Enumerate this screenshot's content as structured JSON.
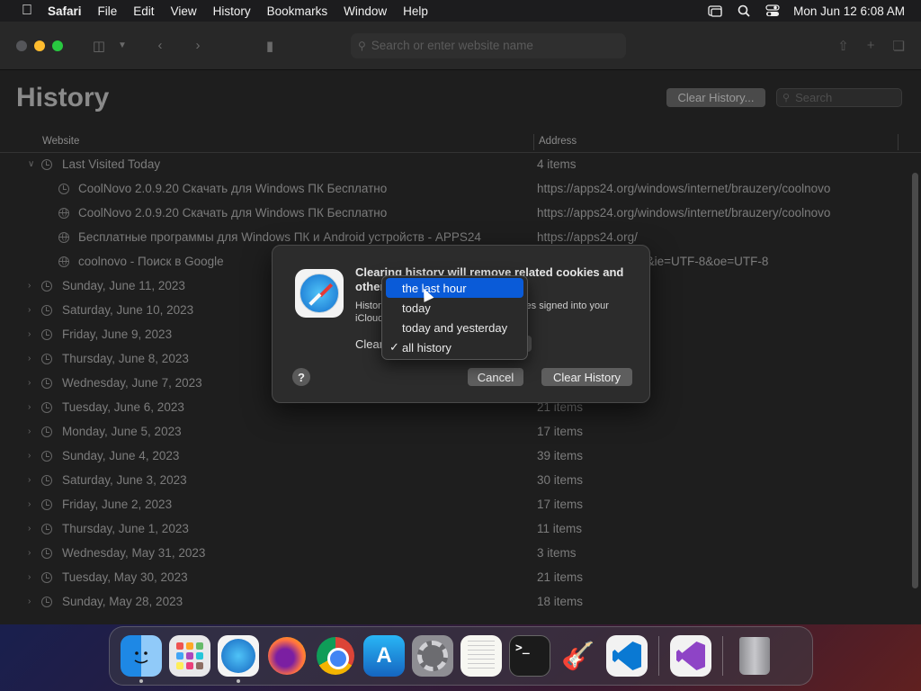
{
  "menubar": {
    "items": [
      "Safari",
      "File",
      "Edit",
      "View",
      "History",
      "Bookmarks",
      "Window",
      "Help"
    ],
    "clock": "Mon Jun 12  6:08 AM"
  },
  "toolbar": {
    "address_placeholder": "Search or enter website name"
  },
  "history": {
    "title": "History",
    "clear_button": "Clear History...",
    "search_placeholder": "Search",
    "col_website": "Website",
    "col_address": "Address",
    "rows": [
      {
        "type": "group",
        "expanded": true,
        "title": "Last Visited Today",
        "addr": "4 items"
      },
      {
        "type": "child",
        "icon": "clock",
        "title": "CoolNovo 2.0.9.20 Скачать для Windows ПК Бесплатно",
        "addr": "https://apps24.org/windows/internet/brauzery/coolnovo"
      },
      {
        "type": "child",
        "icon": "globe",
        "title": "CoolNovo 2.0.9.20 Скачать для Windows ПК Бесплатно",
        "addr": "https://apps24.org/windows/internet/brauzery/coolnovo"
      },
      {
        "type": "child",
        "icon": "globe",
        "title": "Бесплатные программы для Windows ПК и Android устройств - APPS24",
        "addr": "https://apps24.org/"
      },
      {
        "type": "child",
        "icon": "globe",
        "title": "coolnovo - Поиск в Google",
        "addr": "om/search...oolnovo&ie=UTF-8&oe=UTF-8"
      },
      {
        "type": "group",
        "title": "Sunday, June 11, 2023",
        "addr": ""
      },
      {
        "type": "group",
        "title": "Saturday, June 10, 2023",
        "addr": ""
      },
      {
        "type": "group",
        "title": "Friday, June 9, 2023",
        "addr": ""
      },
      {
        "type": "group",
        "title": "Thursday, June 8, 2023",
        "addr": ""
      },
      {
        "type": "group",
        "title": "Wednesday, June 7, 2023",
        "addr": ""
      },
      {
        "type": "group",
        "title": "Tuesday, June 6, 2023",
        "addr": "21 items"
      },
      {
        "type": "group",
        "title": "Monday, June 5, 2023",
        "addr": "17 items"
      },
      {
        "type": "group",
        "title": "Sunday, June 4, 2023",
        "addr": "39 items"
      },
      {
        "type": "group",
        "title": "Saturday, June 3, 2023",
        "addr": "30 items"
      },
      {
        "type": "group",
        "title": "Friday, June 2, 2023",
        "addr": "17 items"
      },
      {
        "type": "group",
        "title": "Thursday, June 1, 2023",
        "addr": "11 items"
      },
      {
        "type": "group",
        "title": "Wednesday, May 31, 2023",
        "addr": "3 items"
      },
      {
        "type": "group",
        "title": "Tuesday, May 30, 2023",
        "addr": "21 items"
      },
      {
        "type": "group",
        "title": "Sunday, May 28, 2023",
        "addr": "18 items"
      }
    ]
  },
  "dialog": {
    "heading": "Clearing history will remove related cookies and other website data.",
    "body": "History will be cleared on all your devices signed into your iCloud account.",
    "clear_label": "Clear",
    "help": "?",
    "cancel": "Cancel",
    "confirm": "Clear History"
  },
  "dropdown": {
    "options": [
      {
        "label": "the last hour",
        "highlighted": true,
        "checked": false
      },
      {
        "label": "today",
        "highlighted": false,
        "checked": false
      },
      {
        "label": "today and yesterday",
        "highlighted": false,
        "checked": false
      },
      {
        "label": "all history",
        "highlighted": false,
        "checked": true
      }
    ]
  },
  "dock": {
    "apps": [
      "Finder",
      "Launchpad",
      "Safari",
      "Firefox",
      "Google Chrome",
      "App Store",
      "System Settings",
      "TextEdit",
      "Terminal",
      "Instruments",
      "Visual Studio Code",
      "Visual Studio",
      "Trash"
    ]
  },
  "colors": {
    "accent": "#0a5bd8",
    "window_bg": "#1e1e1e"
  }
}
